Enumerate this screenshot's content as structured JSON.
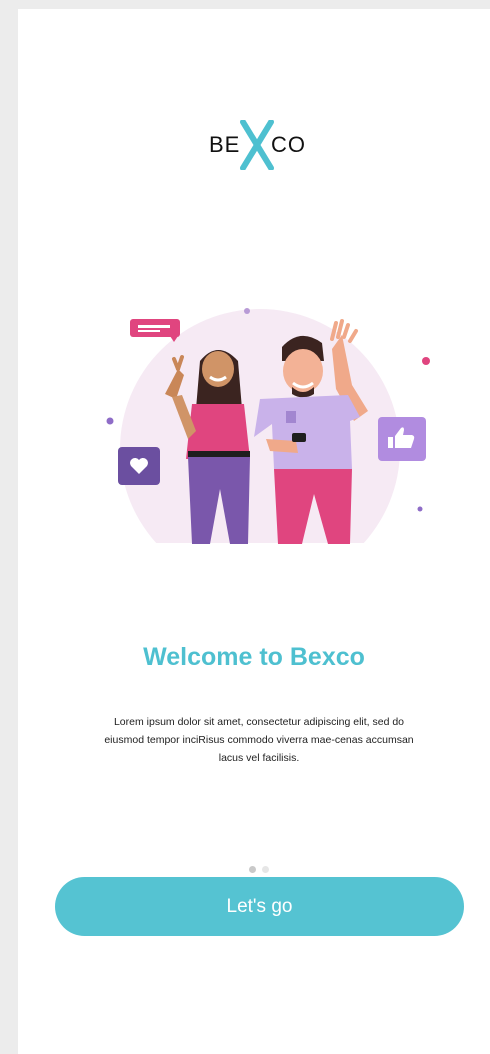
{
  "logo": {
    "left_text": "BE",
    "right_text": "CO",
    "x_letter": "X",
    "accent_color": "#4ec0d0"
  },
  "illustration": {
    "icons": [
      "message-bubble-icon",
      "heart-icon",
      "thumbs-up-icon",
      "smartphone-icon"
    ]
  },
  "welcome": {
    "title": "Welcome to Bexco",
    "description": "Lorem ipsum dolor sit amet, consectetur adipiscing elit, sed do eiusmod tempor inciRisus commodo viverra mae-cenas accumsan lacus vel facilisis."
  },
  "pagination": {
    "total": 2,
    "active_index": 0
  },
  "cta": {
    "label": "Let's go",
    "color": "#55c3d2"
  }
}
